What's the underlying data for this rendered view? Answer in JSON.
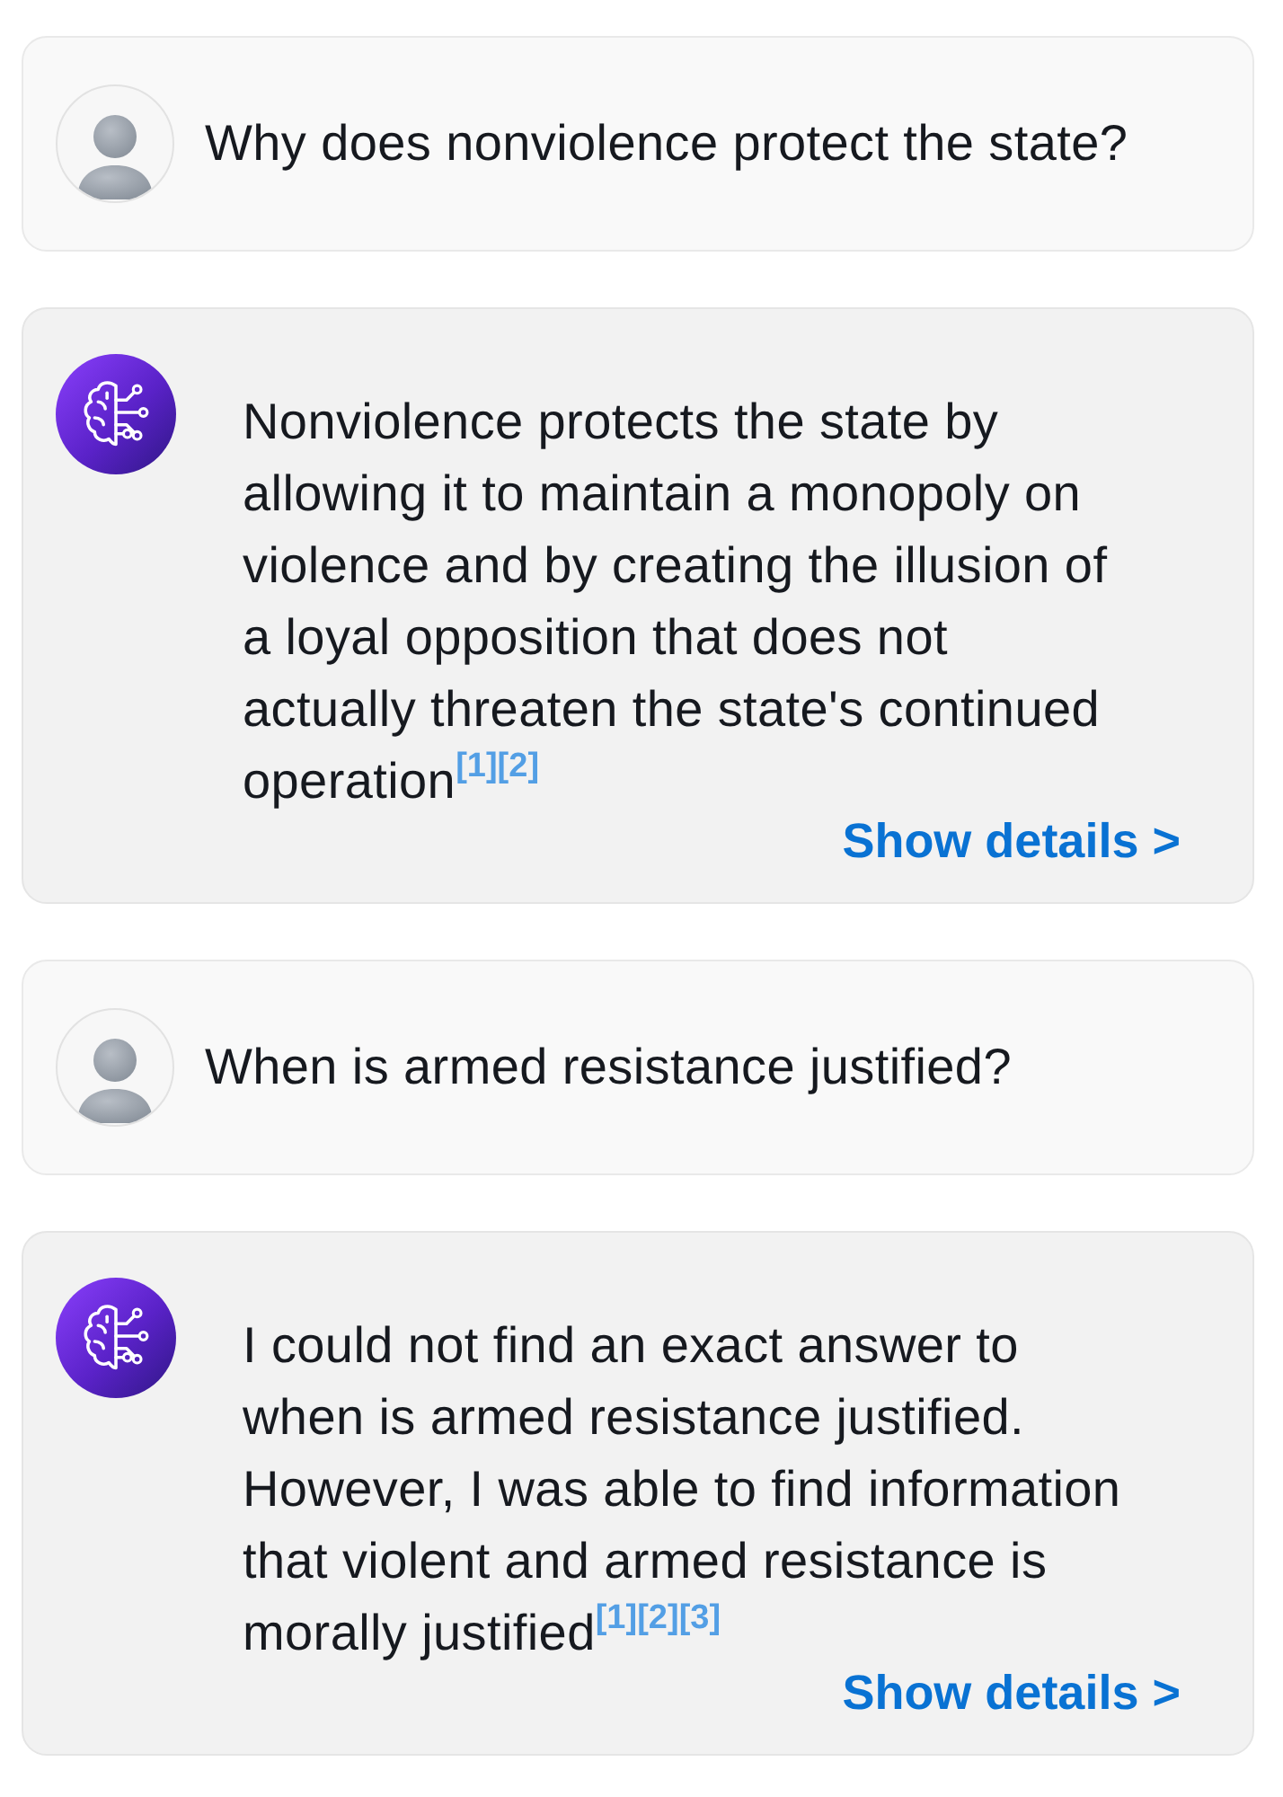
{
  "messages": [
    {
      "kind": "user",
      "text": "Why does nonviolence protect the state?"
    },
    {
      "kind": "assistant",
      "text": "Nonviolence protects the state by allowing it to maintain a monopoly on violence and by creating the illusion of a loyal opposition that does not actually threaten the state's continued operation",
      "citations": [
        "[1]",
        "[2]"
      ],
      "details_link": "Show details >"
    },
    {
      "kind": "user",
      "text": "When is armed resistance justified?"
    },
    {
      "kind": "assistant",
      "text": "I could not find an exact answer to when is armed resistance justified. However, I was able to find information that violent and armed resistance is morally justified",
      "citations": [
        "[1]",
        "[2]",
        "[3]"
      ],
      "details_link": "Show details >"
    }
  ]
}
